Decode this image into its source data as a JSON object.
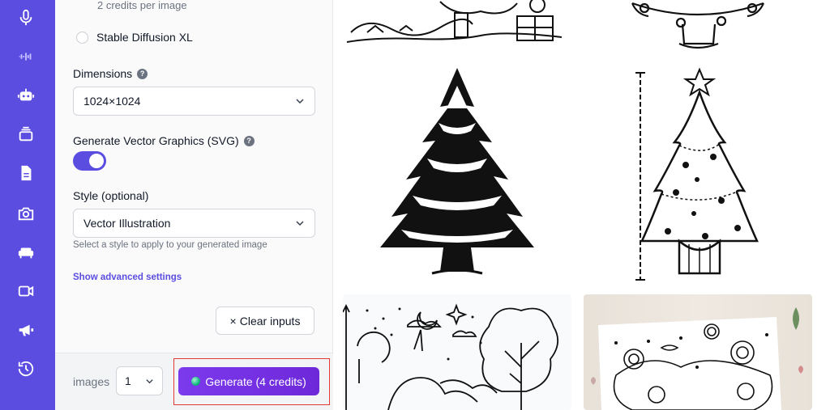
{
  "sidebar": {
    "icons": [
      "microphone-icon",
      "audio-wave-icon",
      "robot-icon",
      "layers-icon",
      "document-icon",
      "camera-icon",
      "sofa-icon",
      "video-icon",
      "megaphone-icon",
      "history-icon"
    ]
  },
  "settings": {
    "model_note": "2 credits per image",
    "model_option_sdxl": "Stable Diffusion XL",
    "dimensions_label": "Dimensions",
    "dimensions_value": "1024×1024",
    "vector_label": "Generate Vector Graphics (SVG)",
    "vector_enabled": true,
    "style_label": "Style (optional)",
    "style_value": "Vector Illustration",
    "style_hint": "Select a style to apply to your generated image",
    "advanced_link": "Show advanced settings",
    "clear_button": "Clear inputs",
    "clear_icon": "×"
  },
  "footer": {
    "images_label": "images",
    "images_count": "1",
    "generate_button": "Generate (4 credits)"
  },
  "colors": {
    "accent": "#5b4de0",
    "generate": "#7c3aed",
    "highlight_outline": "#e53935"
  }
}
